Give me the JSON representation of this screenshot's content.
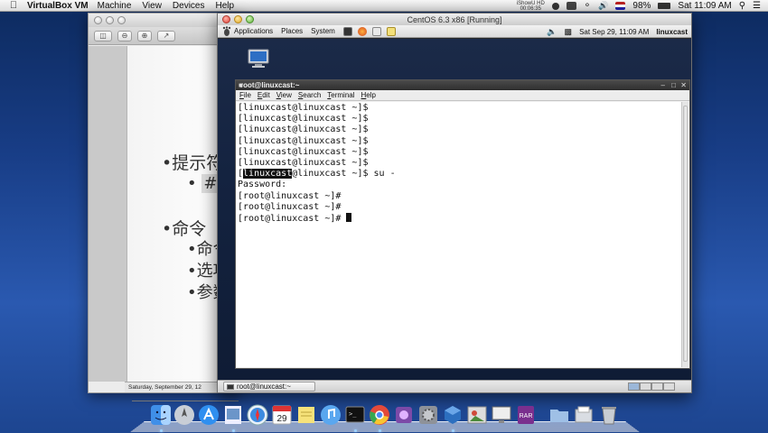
{
  "mac_menubar": {
    "app_name": "VirtualBox VM",
    "menus": [
      "Machine",
      "View",
      "Devices",
      "Help"
    ],
    "ishow_label": "iShowU HD",
    "ishow_time": "00:06:35",
    "battery": "98%",
    "clock": "Sat 11:09 AM"
  },
  "doc_window": {
    "bullets": [
      "提示符",
      "#",
      "命令",
      "命令",
      "选项",
      "参数"
    ],
    "status_date": "Saturday, September 29, 12"
  },
  "vbox": {
    "title": "CentOS 6.3 x86 [Running]"
  },
  "gnome_panel": {
    "menus": [
      "Applications",
      "Places",
      "System"
    ],
    "datetime": "Sat Sep 29, 11:09 AM",
    "user": "linuxcast"
  },
  "terminal": {
    "title": "root@linuxcast:~",
    "menus": [
      "File",
      "Edit",
      "View",
      "Search",
      "Terminal",
      "Help"
    ],
    "lines": [
      "[linuxcast@linuxcast ~]$",
      "[linuxcast@linuxcast ~]$",
      "[linuxcast@linuxcast ~]$",
      "[linuxcast@linuxcast ~]$",
      "[linuxcast@linuxcast ~]$",
      "[linuxcast@linuxcast ~]$"
    ],
    "su_line": {
      "open": "[",
      "highlight": "linuxcast",
      "rest": "@linuxcast ~]$ su -"
    },
    "password_line": "Password:",
    "root_lines": [
      "[root@linuxcast ~]#",
      "[root@linuxcast ~]#",
      "[root@linuxcast ~]# "
    ]
  },
  "guest_taskbar": {
    "task_label": "root@linuxcast:~"
  },
  "dock": {
    "calendar_day": "29",
    "icons": [
      "finder-icon",
      "launchpad-icon",
      "app-store-icon",
      "preview-icon",
      "safari-icon",
      "calendar-icon",
      "notes-icon",
      "itunes-icon",
      "terminal-icon",
      "chrome-icon",
      "app-icon",
      "system-preferences-icon",
      "virtualbox-icon",
      "photo-icon",
      "screen-icon",
      "rar-icon",
      "folder-icon",
      "documents-icon",
      "trash-icon"
    ]
  }
}
